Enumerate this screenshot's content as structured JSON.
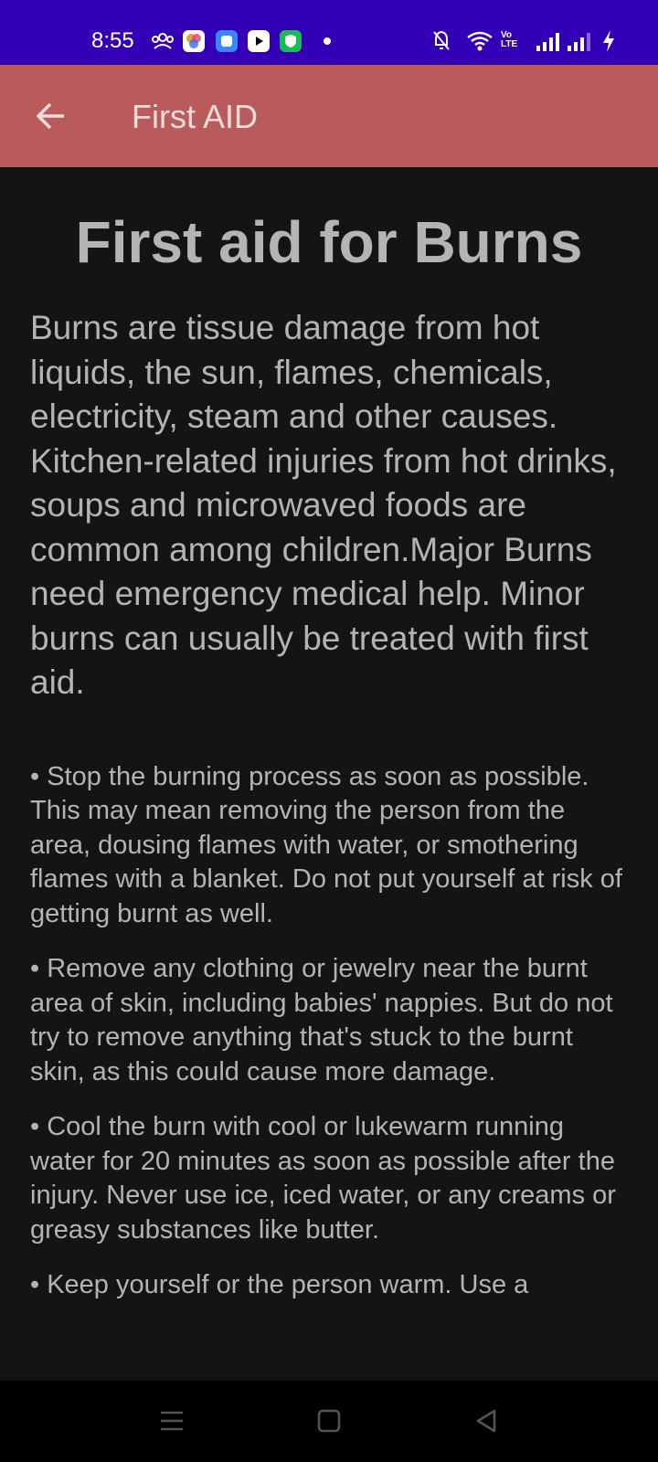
{
  "status_bar": {
    "time": "8:55",
    "left_icons": [
      "group-icon",
      "photos-app-icon",
      "chat-app-icon",
      "youtube-icon",
      "shield-app-icon"
    ],
    "right_icons": [
      "mute-bell-icon",
      "wifi-icon",
      "volte-icon",
      "signal-icon",
      "signal-2-icon",
      "charging-icon"
    ],
    "volte_text": "Vo LTE",
    "colors": {
      "background": "#3300b8"
    }
  },
  "app_bar": {
    "title": "First AID",
    "back_icon": "arrow-left-icon",
    "colors": {
      "background": "#b95b5b",
      "text": "#f4dada"
    }
  },
  "content": {
    "title": "First aid for Burns",
    "intro": "Burns are tissue damage from hot liquids, the sun, flames, chemicals, electricity, steam and other causes. Kitchen-related injuries from hot drinks, soups and microwaved foods are common among children.Major Burns need emergency medical help. Minor burns can usually be treated with first aid.",
    "points": [
      "• Stop the burning process as soon as possible. This may mean removing the person from the area, dousing flames with water, or smothering flames with a blanket. Do not put yourself at risk of getting burnt as well.",
      "• Remove any clothing or jewelry near the burnt area of skin, including babies' nappies. But do not try to remove anything that's stuck to the burnt skin, as this could cause more damage.",
      "• Cool the burn with cool or lukewarm running water for 20 minutes as soon as possible after the injury. Never use ice, iced water, or any creams or greasy substances like butter.",
      "• Keep yourself or the person warm. Use a"
    ],
    "colors": {
      "background": "#141414",
      "text": "#b4b4b4"
    }
  },
  "nav_bar": {
    "buttons": [
      "menu-icon",
      "home-icon",
      "back-triangle-icon"
    ]
  }
}
